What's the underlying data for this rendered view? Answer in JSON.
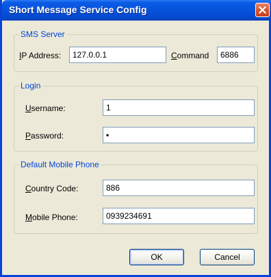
{
  "window": {
    "title": "Short Message Service Config"
  },
  "sms_server": {
    "legend": "SMS Server",
    "ip_label_mnemonic": "I",
    "ip_label_rest": "P Address:",
    "ip_value": "127.0.0.1",
    "command_label_mnemonic": "C",
    "command_label_rest": "ommand",
    "command_value": "6886"
  },
  "login": {
    "legend": "Login",
    "username_label_mnemonic": "U",
    "username_label_rest": "sername:",
    "username_value": "1",
    "password_label_mnemonic": "P",
    "password_label_rest": "assword:",
    "password_value": "•"
  },
  "mobile": {
    "legend": "Default Mobile Phone",
    "country_label_mnemonic": "C",
    "country_label_rest": "ountry Code:",
    "country_value": "886",
    "phone_label_mnemonic": "M",
    "phone_label_rest": "obile Phone:",
    "phone_value": "0939234691"
  },
  "buttons": {
    "ok": "OK",
    "cancel": "Cancel"
  },
  "icons": {
    "close": "close-icon"
  },
  "colors": {
    "title_bar": "#0651d8",
    "group_legend": "#0046d5",
    "dialog_bg": "#ece9d8"
  }
}
